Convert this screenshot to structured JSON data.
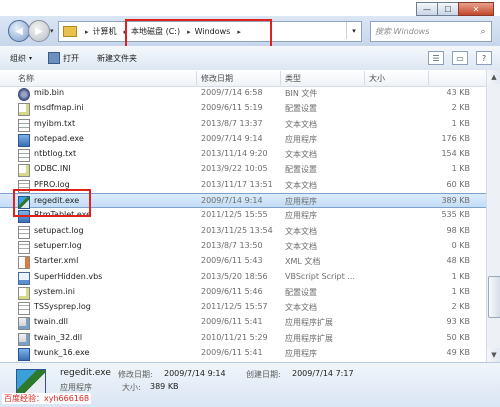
{
  "window": {
    "min_glyph": "—",
    "max_glyph": "☐",
    "close_glyph": "✕"
  },
  "address": {
    "crumbs": [
      "计算机",
      "本地磁盘 (C:)",
      "Windows"
    ],
    "separator": "▸",
    "search_placeholder": "搜索 Windows"
  },
  "toolbar": {
    "organize": "组织",
    "open": "打开",
    "new_folder": "新建文件夹"
  },
  "columns": {
    "name": "名称",
    "date": "修改日期",
    "type": "类型",
    "size": "大小"
  },
  "files": [
    {
      "name": "mib.bin",
      "date": "2009/7/14 6:58",
      "type": "BIN 文件",
      "size": "43 KB",
      "icon": "bin-file-icon"
    },
    {
      "name": "msdfmap.ini",
      "date": "2009/6/11 5:19",
      "type": "配置设置",
      "size": "2 KB",
      "icon": "ini-file-icon"
    },
    {
      "name": "myibm.txt",
      "date": "2013/8/7 13:37",
      "type": "文本文档",
      "size": "1 KB",
      "icon": "text-file-icon"
    },
    {
      "name": "notepad.exe",
      "date": "2009/7/14 9:14",
      "type": "应用程序",
      "size": "176 KB",
      "icon": "exe-file-icon"
    },
    {
      "name": "ntbtlog.txt",
      "date": "2013/11/14 9:20",
      "type": "文本文档",
      "size": "154 KB",
      "icon": "text-file-icon"
    },
    {
      "name": "ODBC.INI",
      "date": "2013/9/22 10:05",
      "type": "配置设置",
      "size": "1 KB",
      "icon": "ini-file-icon"
    },
    {
      "name": "PFRO.log",
      "date": "2013/11/17 13:51",
      "type": "文本文档",
      "size": "60 KB",
      "icon": "log-file-icon"
    },
    {
      "name": "regedit.exe",
      "date": "2009/7/14 9:14",
      "type": "应用程序",
      "size": "389 KB",
      "icon": "regedit-icon",
      "selected": true
    },
    {
      "name": "RtmTablet.exe",
      "date": "2011/12/5 15:55",
      "type": "应用程序",
      "size": "535 KB",
      "icon": "exe-file-icon"
    },
    {
      "name": "setupact.log",
      "date": "2013/11/25 13:54",
      "type": "文本文档",
      "size": "98 KB",
      "icon": "log-file-icon"
    },
    {
      "name": "setuperr.log",
      "date": "2013/8/7 13:50",
      "type": "文本文档",
      "size": "0 KB",
      "icon": "log-file-icon"
    },
    {
      "name": "Starter.xml",
      "date": "2009/6/11 5:43",
      "type": "XML 文档",
      "size": "48 KB",
      "icon": "xml-file-icon"
    },
    {
      "name": "SuperHidden.vbs",
      "date": "2013/5/20 18:56",
      "type": "VBScript Script ...",
      "size": "1 KB",
      "icon": "vbs-file-icon"
    },
    {
      "name": "system.ini",
      "date": "2009/6/11 5:46",
      "type": "配置设置",
      "size": "1 KB",
      "icon": "ini-file-icon"
    },
    {
      "name": "TSSysprep.log",
      "date": "2011/12/5 15:57",
      "type": "文本文档",
      "size": "2 KB",
      "icon": "log-file-icon"
    },
    {
      "name": "twain.dll",
      "date": "2009/6/11 5:41",
      "type": "应用程序扩展",
      "size": "93 KB",
      "icon": "dll-file-icon"
    },
    {
      "name": "twain_32.dll",
      "date": "2010/11/21 5:29",
      "type": "应用程序扩展",
      "size": "50 KB",
      "icon": "dll-file-icon"
    },
    {
      "name": "twunk_16.exe",
      "date": "2009/6/11 5:41",
      "type": "应用程序",
      "size": "49 KB",
      "icon": "exe-file-icon"
    }
  ],
  "details": {
    "name": "regedit.exe",
    "modified_label": "修改日期:",
    "modified": "2009/7/14 9:14",
    "created_label": "创建日期:",
    "created": "2009/7/14 7:17",
    "type": "应用程序",
    "size_label": "大小:",
    "size": "389 KB"
  },
  "watermark": "百度经验：xyh666168"
}
